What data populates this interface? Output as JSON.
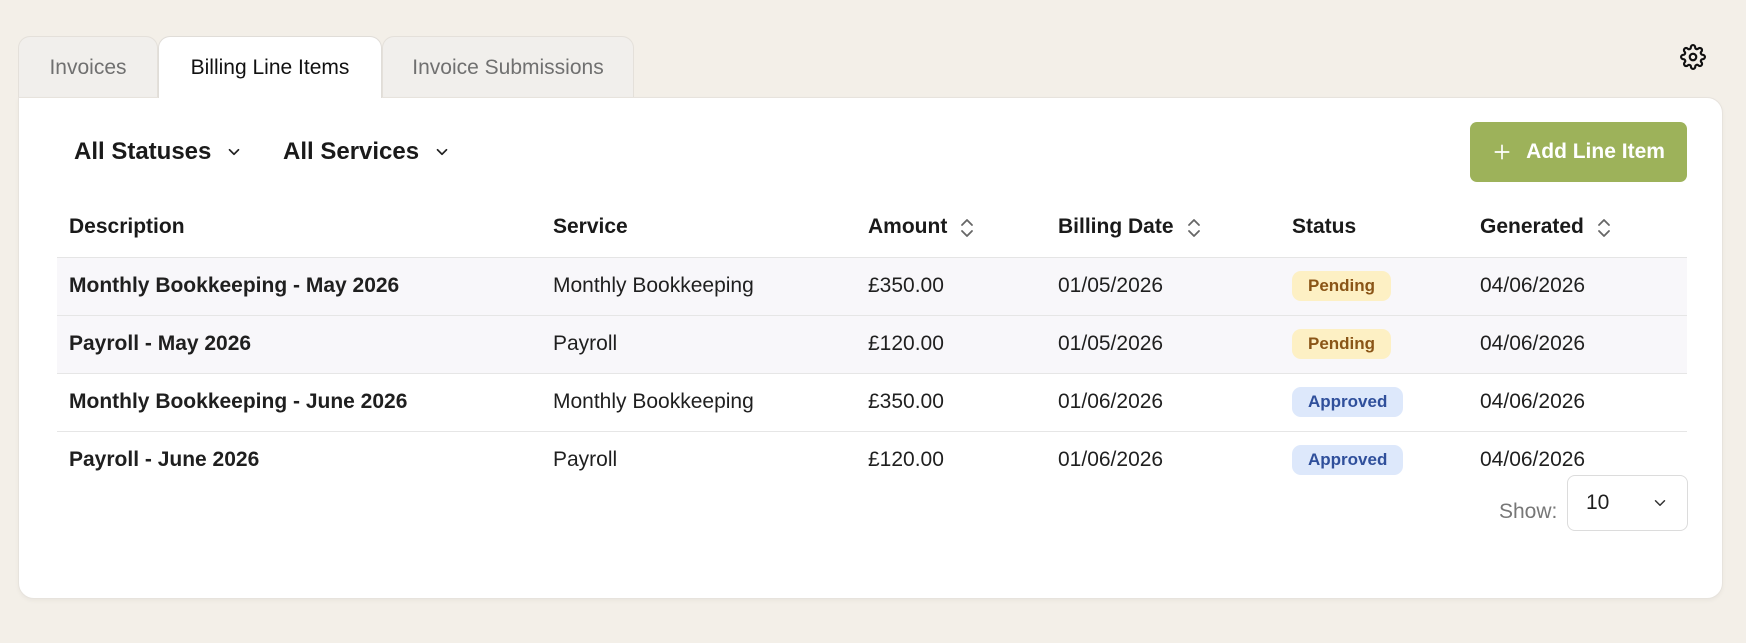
{
  "tabs": [
    {
      "label": "Invoices"
    },
    {
      "label": "Billing Line Items"
    },
    {
      "label": "Invoice Submissions"
    }
  ],
  "filters": {
    "status_label": "All Statuses",
    "service_label": "All Services"
  },
  "toolbar": {
    "add_label": "Add Line Item"
  },
  "colors": {
    "accent": "#9db25a",
    "pending_bg": "#fdf0c4",
    "approved_bg": "#dde8fb"
  },
  "table": {
    "headers": {
      "description": "Description",
      "service": "Service",
      "amount": "Amount",
      "billing_date": "Billing Date",
      "status": "Status",
      "generated": "Generated"
    },
    "rows": [
      {
        "description": "Monthly Bookkeeping - May 2026",
        "service": "Monthly Bookkeeping",
        "amount": "£350.00",
        "billing_date": "01/05/2026",
        "status": "Pending",
        "generated": "04/06/2026"
      },
      {
        "description": "Payroll - May 2026",
        "service": "Payroll",
        "amount": "£120.00",
        "billing_date": "01/05/2026",
        "status": "Pending",
        "generated": "04/06/2026"
      },
      {
        "description": "Monthly Bookkeeping - June 2026",
        "service": "Monthly Bookkeeping",
        "amount": "£350.00",
        "billing_date": "01/06/2026",
        "status": "Approved",
        "generated": "04/06/2026"
      },
      {
        "description": "Payroll - June 2026",
        "service": "Payroll",
        "amount": "£120.00",
        "billing_date": "01/06/2026",
        "status": "Approved",
        "generated": "04/06/2026"
      }
    ]
  },
  "pagination": {
    "show_label": "Show:",
    "page_size": "10"
  }
}
